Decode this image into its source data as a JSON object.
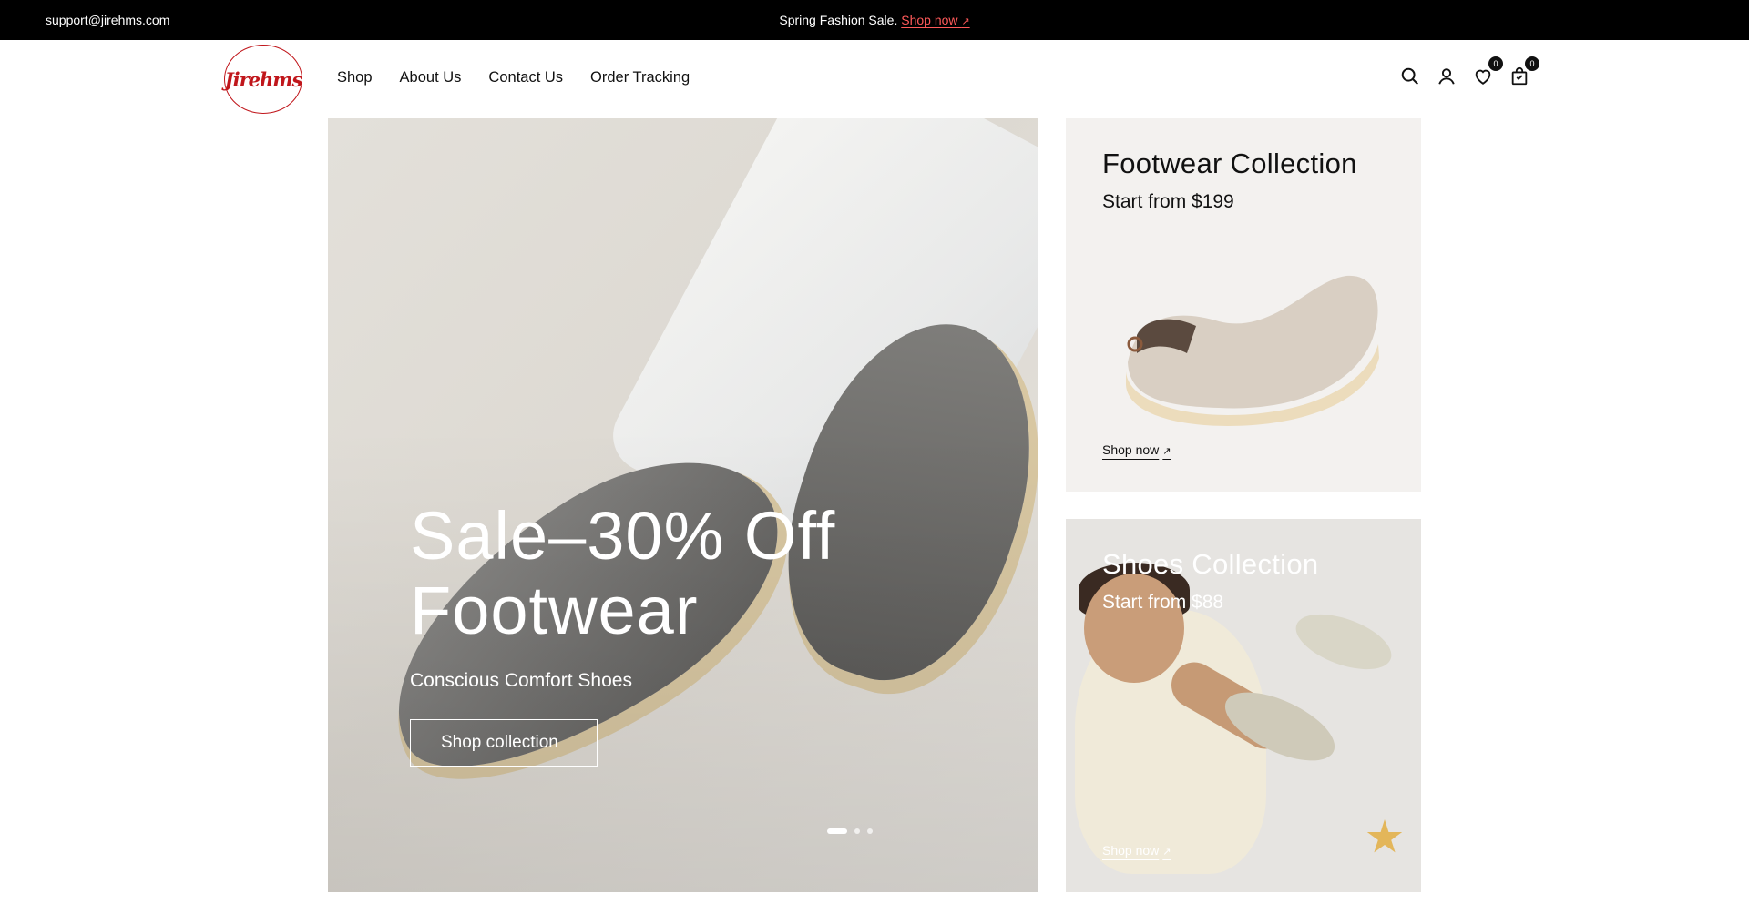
{
  "topbar": {
    "email": "support@jirehms.com",
    "promo_text": "Spring Fashion Sale.",
    "promo_link": "Shop now",
    "promo_arrow": "↗"
  },
  "header": {
    "logo_text": "Jirehms",
    "nav": [
      "Shop",
      "About Us",
      "Contact Us",
      "Order Tracking"
    ],
    "wishlist_count": "0",
    "cart_count": "0"
  },
  "hero": {
    "title_line1": "Sale–30% Off",
    "title_line2": "Footwear",
    "subtitle": "Conscious Comfort Shoes",
    "button": "Shop collection",
    "slides": 3,
    "active_slide": 1
  },
  "cards": [
    {
      "title": "Footwear Collection",
      "subtitle": "Start from $199",
      "link": "Shop now",
      "arrow": "↗"
    },
    {
      "title": "Shoes Collection",
      "subtitle": "Start from $88",
      "link": "Shop now",
      "arrow": "↗"
    }
  ],
  "colors": {
    "topbar_bg": "#000000",
    "promo_link": "#ff5a5a",
    "logo_red": "#c0161b",
    "card1_bg": "#f3f1ef"
  }
}
